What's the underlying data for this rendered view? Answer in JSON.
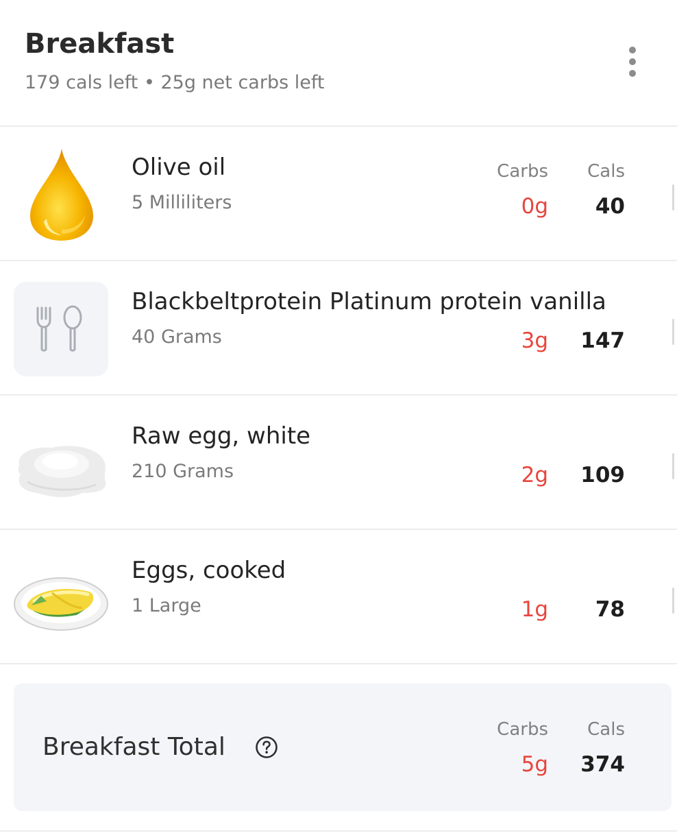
{
  "meal": {
    "title": "Breakfast",
    "subtitle": "179 cals left • 25g net carbs left",
    "menu_icon": "more-vertical-icon"
  },
  "columns": {
    "carbs": "Carbs",
    "cals": "Cals"
  },
  "items": [
    {
      "name": "Olive oil",
      "amount": "5 Milliliters",
      "carbs": "0g",
      "cals": "40",
      "icon": "oil-drop-icon",
      "show_headers": true
    },
    {
      "name": "Blackbeltprotein Platinum protein vanilla",
      "amount": "40 Grams",
      "carbs": "3g",
      "cals": "147",
      "icon": "fork-spoon-icon",
      "show_headers": false
    },
    {
      "name": "Raw egg, white",
      "amount": "210 Grams",
      "carbs": "2g",
      "cals": "109",
      "icon": "egg-white-icon",
      "show_headers": false
    },
    {
      "name": "Eggs, cooked",
      "amount": "1 Large",
      "carbs": "1g",
      "cals": "78",
      "icon": "omelette-icon",
      "show_headers": false
    }
  ],
  "total": {
    "label": "Breakfast Total",
    "carbs_header": "Carbs",
    "cals_header": "Cals",
    "carbs": "5g",
    "cals": "374",
    "help_icon": "help-circle-icon"
  },
  "colors": {
    "carbs_value": "#e8453c",
    "panel_bg": "#f3f5f8",
    "divider": "#ececec"
  }
}
